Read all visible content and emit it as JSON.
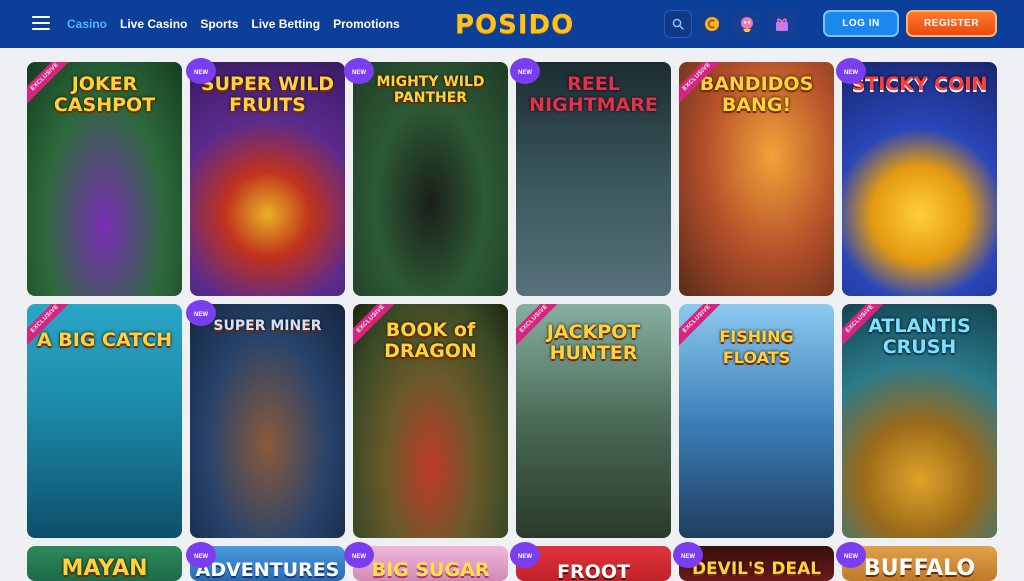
{
  "header": {
    "nav": [
      {
        "label": "Casino",
        "active": true
      },
      {
        "label": "Live Casino",
        "active": false
      },
      {
        "label": "Sports",
        "active": false
      },
      {
        "label": "Live Betting",
        "active": false
      },
      {
        "label": "Promotions",
        "active": false
      }
    ],
    "logo": "POSIDO",
    "login": "LOG IN",
    "register": "REGISTER"
  },
  "badges": {
    "exclusive": "EXCLUSIVE",
    "new": "NEW"
  },
  "games_row1": [
    {
      "title": "JOKER CASHPOT",
      "tag": "exclusive",
      "bg": "#2c6a3a"
    },
    {
      "title": "SUPER WILD FRUITS",
      "tag": "new",
      "bg": "#5b2b8c"
    },
    {
      "title": "MIGHTY WILD PANTHER",
      "tag": "new",
      "bg": "#1f3a25"
    },
    {
      "title": "REEL NIGHTMARE",
      "tag": "new",
      "bg": "#25404a"
    },
    {
      "title": "BANDIDOS BANG!",
      "tag": "exclusive",
      "bg": "#b5512a"
    },
    {
      "title": "STICKY COIN",
      "tag": "new",
      "bg": "#2a46b8"
    }
  ],
  "games_row2": [
    {
      "title": "A BIG CATCH",
      "tag": "exclusive",
      "bg": "#1c89a8"
    },
    {
      "title": "SUPER MINER",
      "tag": "new",
      "bg": "#27436b"
    },
    {
      "title": "BOOK of DRAGON",
      "tag": "exclusive",
      "bg": "#3a4a26"
    },
    {
      "title": "JACKPOT HUNTER",
      "tag": "exclusive",
      "bg": "#4a6a57"
    },
    {
      "title": "FISHING FLOATS",
      "tag": "exclusive",
      "bg": "#3d7fb8"
    },
    {
      "title": "ATLANTIS CRUSH",
      "tag": "exclusive",
      "bg": "#2c7a8a"
    }
  ],
  "games_row3": [
    {
      "title": "MAYAN",
      "tag": "",
      "bg": "#1e6a4a"
    },
    {
      "title": "ADVENTURES",
      "tag": "new",
      "bg": "#2a6ab0"
    },
    {
      "title": "BIG SUGAR",
      "tag": "new",
      "bg": "#d08ab8"
    },
    {
      "title": "FROOT",
      "tag": "new",
      "bg": "#c0222a"
    },
    {
      "title": "DEVIL'S DEAL",
      "tag": "new",
      "bg": "#6a1a1a"
    },
    {
      "title": "BUFFALO",
      "tag": "new",
      "bg": "#c07a2a"
    }
  ],
  "colors": {
    "header": "#0b3f9a",
    "accent": "#4fb3ff",
    "register": "#ea4a10",
    "login": "#1a88ee"
  }
}
